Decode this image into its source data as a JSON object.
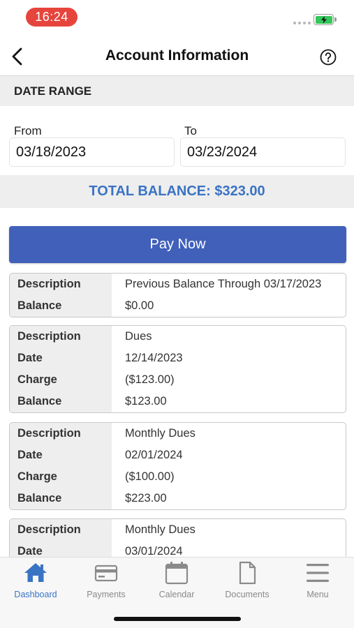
{
  "status_bar": {
    "time": "16:24",
    "battery_color": "#34c759"
  },
  "header": {
    "title": "Account Information",
    "back_icon": "chevron-left-icon",
    "help_icon": "question-circle-icon"
  },
  "date_range": {
    "section_title": "DATE RANGE",
    "from_label": "From",
    "from_value": "03/18/2023",
    "to_label": "To",
    "to_value": "03/23/2024"
  },
  "total_balance": {
    "text": "TOTAL BALANCE: $323.00",
    "color": "#3a73c4"
  },
  "pay_button": {
    "label": "Pay Now",
    "color": "#4060ba"
  },
  "transactions": [
    {
      "rows": [
        {
          "label": "Description",
          "value": "Previous Balance Through 03/17/2023"
        },
        {
          "label": "Balance",
          "value": "$0.00"
        }
      ]
    },
    {
      "rows": [
        {
          "label": "Description",
          "value": "Dues"
        },
        {
          "label": "Date",
          "value": "12/14/2023"
        },
        {
          "label": "Charge",
          "value": "($123.00)"
        },
        {
          "label": "Balance",
          "value": "$123.00"
        }
      ]
    },
    {
      "rows": [
        {
          "label": "Description",
          "value": "Monthly Dues"
        },
        {
          "label": "Date",
          "value": "02/01/2024"
        },
        {
          "label": "Charge",
          "value": "($100.00)"
        },
        {
          "label": "Balance",
          "value": "$223.00"
        }
      ]
    },
    {
      "rows": [
        {
          "label": "Description",
          "value": "Monthly Dues"
        },
        {
          "label": "Date",
          "value": "03/01/2024"
        }
      ]
    }
  ],
  "tab_bar": {
    "active_color": "#3a73c4",
    "inactive_color": "#8a8a8a",
    "tabs": [
      {
        "label": "Dashboard",
        "icon": "home-icon",
        "active": true
      },
      {
        "label": "Payments",
        "icon": "credit-card-icon",
        "active": false
      },
      {
        "label": "Calendar",
        "icon": "calendar-icon",
        "active": false
      },
      {
        "label": "Documents",
        "icon": "document-icon",
        "active": false
      },
      {
        "label": "Menu",
        "icon": "hamburger-menu-icon",
        "active": false
      }
    ]
  }
}
